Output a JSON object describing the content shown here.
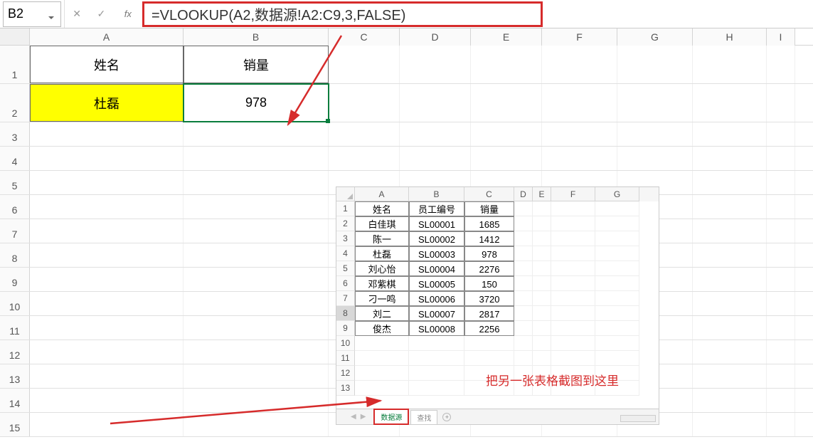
{
  "formula_bar": {
    "cell_ref": "B2",
    "formula": "=VLOOKUP(A2,数据源!A2:C9,3,FALSE)"
  },
  "main_columns": [
    "A",
    "B",
    "C",
    "D",
    "E",
    "F",
    "G",
    "H",
    "I"
  ],
  "main_headers": {
    "A": "姓名",
    "B": "销量"
  },
  "main_data": {
    "A2": "杜磊",
    "B2": "978"
  },
  "main_row_numbers": [
    "1",
    "2",
    "3",
    "4",
    "5",
    "6",
    "7",
    "8",
    "9",
    "10",
    "11",
    "12",
    "13",
    "14",
    "15"
  ],
  "inset": {
    "columns": [
      "A",
      "B",
      "C",
      "D",
      "E",
      "F",
      "G"
    ],
    "rows": [
      {
        "n": "1",
        "A": "姓名",
        "B": "员工编号",
        "C": "销量"
      },
      {
        "n": "2",
        "A": "白佳琪",
        "B": "SL00001",
        "C": "1685"
      },
      {
        "n": "3",
        "A": "陈一",
        "B": "SL00002",
        "C": "1412"
      },
      {
        "n": "4",
        "A": "杜磊",
        "B": "SL00003",
        "C": "978"
      },
      {
        "n": "5",
        "A": "刘心怡",
        "B": "SL00004",
        "C": "2276"
      },
      {
        "n": "6",
        "A": "邓紫棋",
        "B": "SL00005",
        "C": "150"
      },
      {
        "n": "7",
        "A": "刁一鸣",
        "B": "SL00006",
        "C": "3720"
      },
      {
        "n": "8",
        "A": "刘二",
        "B": "SL00007",
        "C": "2817"
      },
      {
        "n": "9",
        "A": "俊杰",
        "B": "SL00008",
        "C": "2256"
      }
    ],
    "blank_rows": [
      "10",
      "11",
      "12",
      "13"
    ],
    "annotation": "把另一张表格截图到这里",
    "tabs": {
      "active": "数据源",
      "other": "查找"
    }
  }
}
